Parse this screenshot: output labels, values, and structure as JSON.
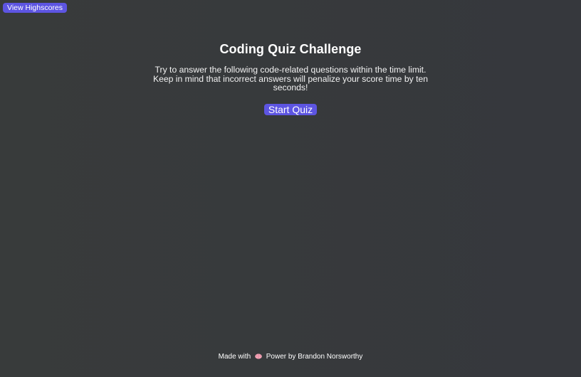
{
  "header": {
    "highscores_label": "View Highscores"
  },
  "main": {
    "title": "Coding Quiz Challenge",
    "intro": "Try to answer the following code-related questions within the time limit. Keep in mind that incorrect answers will penalize your score time by ten seconds!",
    "start_label": "Start Quiz"
  },
  "footer": {
    "made_with": "Made with",
    "icon": "brain-icon",
    "credit": "Power by Brandon Norsworthy"
  },
  "colors": {
    "accent": "#5d55e2",
    "background": "#36383d",
    "text": "#ffffff"
  }
}
